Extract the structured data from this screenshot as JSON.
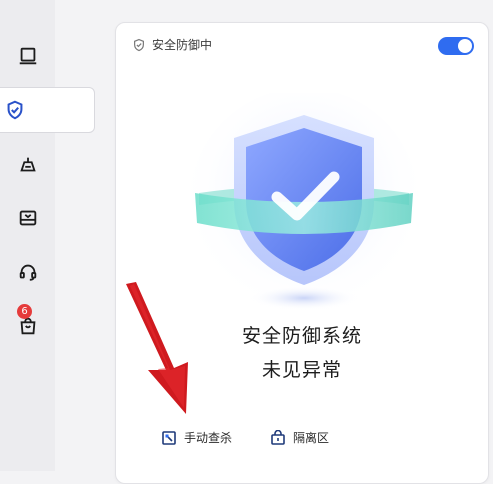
{
  "sidebar": {
    "items": [
      {
        "icon": "device-icon"
      },
      {
        "icon": "shield-check-icon",
        "active": true
      },
      {
        "icon": "cleaner-icon"
      },
      {
        "icon": "install-box-icon"
      },
      {
        "icon": "headset-icon"
      },
      {
        "icon": "shopping-bag-icon",
        "badge": "6"
      }
    ]
  },
  "card": {
    "status_text": "安全防御中",
    "toggle_on": true,
    "headline_line1": "安全防御系统",
    "headline_line2": "未见异常",
    "actions": [
      {
        "label": "手动查杀",
        "icon": "scan-icon"
      },
      {
        "label": "隔离区",
        "icon": "quarantine-box-icon"
      }
    ]
  },
  "colors": {
    "accent": "#2f6cf0",
    "badge": "#e53b3b",
    "arrow": "#d0141b",
    "shield": "#5b7ff0",
    "ring": "#5fd6c6"
  }
}
